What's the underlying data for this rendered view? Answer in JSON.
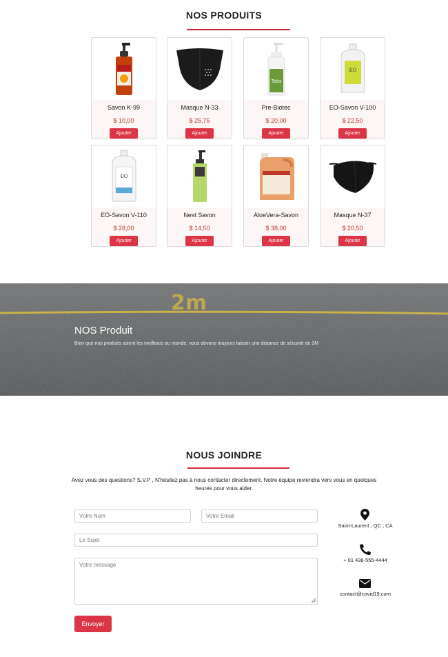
{
  "products_section": {
    "title": "NOS PRODUITS",
    "add_label": "Ajouter",
    "items": [
      {
        "name": "Savon K-99",
        "price": "$ 10,00",
        "image": "orange-pump-bottle"
      },
      {
        "name": "Masque N-33",
        "price": "$ 25,75",
        "image": "black-neoprene-mask"
      },
      {
        "name": "Pre-Biotec",
        "price": "$ 20,00",
        "image": "green-label-pump-bottle"
      },
      {
        "name": "EO-Savon V-100",
        "price": "$ 22,50",
        "image": "lime-label-jug"
      },
      {
        "name": "EO-Savon V-110",
        "price": "$ 28,00",
        "image": "blue-label-jug"
      },
      {
        "name": "Nest Savon",
        "price": "$ 14,50",
        "image": "green-soap-bottle"
      },
      {
        "name": "AloeVera-Savon",
        "price": "$ 38,00",
        "image": "amber-refill-jug"
      },
      {
        "name": "Masque N-37",
        "price": "$ 20,50",
        "image": "black-cloth-mask"
      }
    ]
  },
  "banner": {
    "title": "NOS Produit",
    "subtitle": "Bien que nos produits soient les meilleurs au monde, nous devons toujours laisser une distance de sécurité de 2M",
    "road_marking": "2m"
  },
  "contact_section": {
    "title": "NOUS JOINDRE",
    "intro": "Avez vous des questions? S.V.P , N'hésitez pas à nous contacter directement. Notre équipe reviendra vers vous en quelques heures pour vous aider.",
    "name_placeholder": "Votre Nom",
    "email_placeholder": "Votre Email",
    "subject_placeholder": "Le Sujet",
    "message_placeholder": "Votre message",
    "send_label": "Envoyer",
    "address": "Saint-Laurent , QC , CA",
    "phone": "+ 01 438-555-4444",
    "email": "contact@covid19.com",
    "icons": [
      "map-marker-icon",
      "phone-icon",
      "envelope-icon"
    ]
  },
  "colors": {
    "accent": "#dc3545",
    "price": "#c0392b",
    "card_info_bg": "#fcf6f6"
  }
}
